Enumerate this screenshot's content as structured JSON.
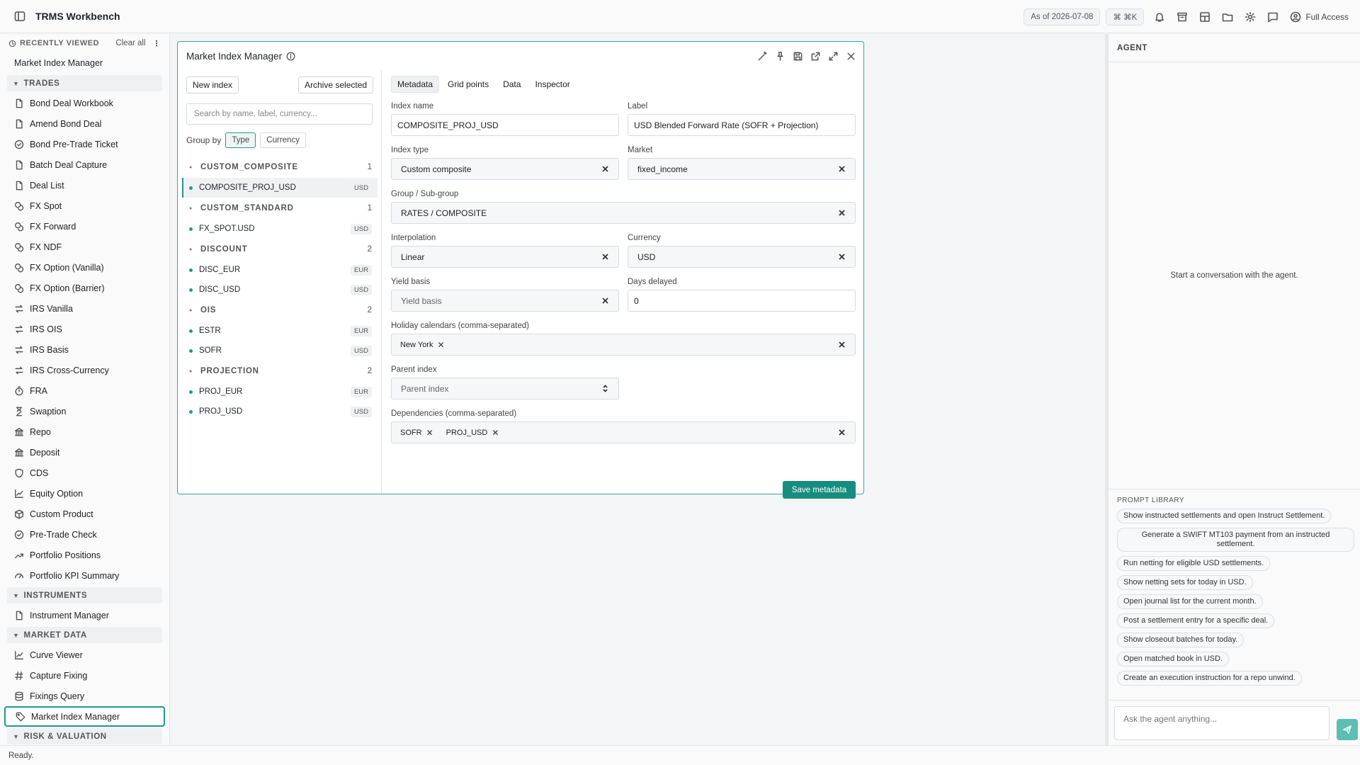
{
  "app": {
    "title": "TRMS Workbench"
  },
  "topbar": {
    "as_of": "As of 2026-07-08",
    "shortcut": "⌘ ⌘K",
    "access": "Full Access"
  },
  "sidebar": {
    "recent_label": "RECENTLY VIEWED",
    "clear_all": "Clear all",
    "recent_items": [
      "Market Index Manager"
    ],
    "sections": [
      {
        "label": "TRADES",
        "items": [
          {
            "label": "Bond Deal Workbook",
            "icon": "document-icon"
          },
          {
            "label": "Amend Bond Deal",
            "icon": "document-icon"
          },
          {
            "label": "Bond Pre-Trade Ticket",
            "icon": "check-circle-icon"
          },
          {
            "label": "Batch Deal Capture",
            "icon": "document-icon"
          },
          {
            "label": "Deal List",
            "icon": "document-icon"
          },
          {
            "label": "FX Spot",
            "icon": "coins-icon"
          },
          {
            "label": "FX Forward",
            "icon": "coins-icon"
          },
          {
            "label": "FX NDF",
            "icon": "coins-icon"
          },
          {
            "label": "FX Option (Vanilla)",
            "icon": "coins-icon"
          },
          {
            "label": "FX Option (Barrier)",
            "icon": "coins-icon"
          },
          {
            "label": "IRS Vanilla",
            "icon": "swap-icon"
          },
          {
            "label": "IRS OIS",
            "icon": "swap-icon"
          },
          {
            "label": "IRS Basis",
            "icon": "swap-icon"
          },
          {
            "label": "IRS Cross-Currency",
            "icon": "swap-icon"
          },
          {
            "label": "FRA",
            "icon": "timer-icon"
          },
          {
            "label": "Swaption",
            "icon": "hourglass-icon"
          },
          {
            "label": "Repo",
            "icon": "bank-icon"
          },
          {
            "label": "Deposit",
            "icon": "bank-icon"
          },
          {
            "label": "CDS",
            "icon": "shield-icon"
          },
          {
            "label": "Equity Option",
            "icon": "line-chart-icon"
          },
          {
            "label": "Custom Product",
            "icon": "cube-icon"
          },
          {
            "label": "Pre-Trade Check",
            "icon": "check-circle-icon"
          },
          {
            "label": "Portfolio Positions",
            "icon": "trend-icon"
          },
          {
            "label": "Portfolio KPI Summary",
            "icon": "gauge-icon"
          }
        ]
      },
      {
        "label": "INSTRUMENTS",
        "items": [
          {
            "label": "Instrument Manager",
            "icon": "document-icon"
          }
        ]
      },
      {
        "label": "MARKET DATA",
        "items": [
          {
            "label": "Curve Viewer",
            "icon": "line-chart-icon"
          },
          {
            "label": "Capture Fixing",
            "icon": "hash-icon"
          },
          {
            "label": "Fixings Query",
            "icon": "database-icon"
          },
          {
            "label": "Market Index Manager",
            "icon": "tag-icon"
          }
        ]
      },
      {
        "label": "RISK & VALUATION",
        "items": []
      }
    ]
  },
  "panel": {
    "title": "Market Index Manager",
    "new_index": "New index",
    "archive_selected": "Archive selected",
    "search_placeholder": "Search by name, label, currency...",
    "group_by_label": "Group by",
    "group_by_options": [
      "Type",
      "Currency"
    ],
    "groups": [
      {
        "name": "CUSTOM_COMPOSITE",
        "count": "1",
        "items": [
          {
            "name": "COMPOSITE_PROJ_USD",
            "ccy": "USD",
            "selected": true
          }
        ]
      },
      {
        "name": "CUSTOM_STANDARD",
        "count": "1",
        "items": [
          {
            "name": "FX_SPOT.USD",
            "ccy": "USD"
          }
        ]
      },
      {
        "name": "DISCOUNT",
        "count": "2",
        "items": [
          {
            "name": "DISC_EUR",
            "ccy": "EUR"
          },
          {
            "name": "DISC_USD",
            "ccy": "USD"
          }
        ]
      },
      {
        "name": "OIS",
        "count": "2",
        "items": [
          {
            "name": "ESTR",
            "ccy": "EUR"
          },
          {
            "name": "SOFR",
            "ccy": "USD"
          }
        ]
      },
      {
        "name": "PROJECTION",
        "count": "2",
        "items": [
          {
            "name": "PROJ_EUR",
            "ccy": "EUR"
          },
          {
            "name": "PROJ_USD",
            "ccy": "USD"
          }
        ]
      }
    ],
    "tabs": [
      "Metadata",
      "Grid points",
      "Data",
      "Inspector"
    ],
    "form": {
      "index_name_label": "Index name",
      "index_name": "COMPOSITE_PROJ_USD",
      "label_label": "Label",
      "label": "USD Blended Forward Rate (SOFR + Projection)",
      "index_type_label": "Index type",
      "index_type": "Custom composite",
      "market_label": "Market",
      "market": "fixed_income",
      "group_label": "Group / Sub-group",
      "group": "RATES / COMPOSITE",
      "interpolation_label": "Interpolation",
      "interpolation": "Linear",
      "currency_label": "Currency",
      "currency": "USD",
      "yield_basis_label": "Yield basis",
      "yield_basis_placeholder": "Yield basis",
      "days_delayed_label": "Days delayed",
      "days_delayed": "0",
      "holiday_label": "Holiday calendars (comma-separated)",
      "holidays": [
        "New York"
      ],
      "parent_label": "Parent index",
      "parent_placeholder": "Parent index",
      "dependencies_label": "Dependencies (comma-separated)",
      "dependencies": [
        "SOFR",
        "PROJ_USD"
      ],
      "save": "Save metadata"
    }
  },
  "agent": {
    "title": "AGENT",
    "empty": "Start a conversation with the agent.",
    "prompt_library_label": "PROMPT LIBRARY",
    "prompts": [
      "Show instructed settlements and open Instruct Settlement.",
      "Generate a SWIFT MT103 payment from an instructed settlement.",
      "Run netting for eligible USD settlements.",
      "Show netting sets for today in USD.",
      "Open journal list for the current month.",
      "Post a settlement entry for a specific deal.",
      "Show closeout batches for today.",
      "Open matched book in USD.",
      "Create an execution instruction for a repo unwind."
    ],
    "ask_placeholder": "Ask the agent anything..."
  },
  "status": "Ready."
}
